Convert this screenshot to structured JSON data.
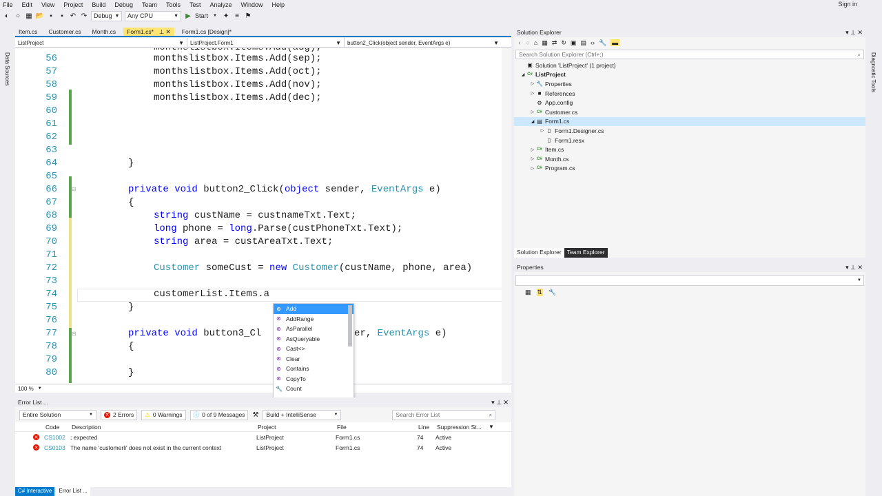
{
  "menu": [
    "File",
    "Edit",
    "View",
    "Project",
    "Build",
    "Debug",
    "Team",
    "Tools",
    "Test",
    "Analyze",
    "Window",
    "Help"
  ],
  "signin": "Sign in",
  "toolbar": {
    "config": "Debug",
    "platform": "Any CPU",
    "start": "Start"
  },
  "left_strip": "Data Sources",
  "right_strip": "Diagnostic Tools",
  "tabs": [
    "Item.cs",
    "Customer.cs",
    "Month.cs",
    "Form1.cs*",
    "Form1.cs [Design]*"
  ],
  "navbar": {
    "project": "ListProject",
    "class": "ListProject.Form1",
    "member": "button2_Click(object sender, EventArgs e)"
  },
  "zoom": "100 %",
  "code_lines": [
    {
      "n": "56",
      "text": "monthslistbox.Items.Add(sep);"
    },
    {
      "n": "57",
      "text": "monthslistbox.Items.Add(oct);"
    },
    {
      "n": "58",
      "text": "monthslistbox.Items.Add(nov);"
    },
    {
      "n": "59",
      "text": "monthslistbox.Items.Add(dec);"
    },
    {
      "n": "60",
      "text": ""
    },
    {
      "n": "61",
      "text": ""
    },
    {
      "n": "62",
      "text": ""
    },
    {
      "n": "63",
      "text": ""
    },
    {
      "n": "64",
      "text": "}"
    },
    {
      "n": "65",
      "text": ""
    },
    {
      "n": "66"
    },
    {
      "n": "67",
      "text": "{"
    },
    {
      "n": "68"
    },
    {
      "n": "69"
    },
    {
      "n": "70"
    },
    {
      "n": "71",
      "text": ""
    },
    {
      "n": "72"
    },
    {
      "n": "73",
      "text": ""
    },
    {
      "n": "74",
      "text": "customerList.Items.a"
    },
    {
      "n": "75",
      "text": "}"
    },
    {
      "n": "76",
      "text": ""
    },
    {
      "n": "77"
    },
    {
      "n": "78",
      "text": "{"
    },
    {
      "n": "79",
      "text": ""
    },
    {
      "n": "80",
      "text": "}"
    }
  ],
  "partial_top": "monthslistbox.Items.Add(aug);",
  "tokens": {
    "private": "private",
    "void": "void",
    "object": "object",
    "string": "string",
    "long": "long",
    "new": "new",
    "eventargs": "EventArgs",
    "customer": "Customer",
    "b2": " button2_Click(",
    "sender_e": " sender, ",
    "e_close": " e)",
    "l68": " custName = custnameTxt.Text;",
    "l69a": " phone = ",
    "l69b": ".Parse(custPhoneTxt.Text);",
    "l70": " area = custAreaTxt.Text;",
    "l72a": " someCust = ",
    "l72b": "(custName, phone, area)",
    "b3": " button3_Cl",
    "b3b": "nder, "
  },
  "intellisense": {
    "items": [
      "Add",
      "AddRange",
      "AsParallel",
      "AsQueryable",
      "Cast<>",
      "Clear",
      "Contains",
      "CopyTo",
      "Count"
    ],
    "selected": 0
  },
  "errorlist": {
    "title": "Error List ...",
    "scope": "Entire Solution",
    "errors": "2 Errors",
    "warnings": "0 Warnings",
    "messages": "0 of 9 Messages",
    "build": "Build + IntelliSense",
    "search_placeholder": "Search Error List",
    "columns": [
      "Code",
      "Description",
      "Project",
      "File",
      "Line",
      "Suppression St..."
    ],
    "rows": [
      {
        "code": "CS1002",
        "desc": "; expected",
        "project": "ListProject",
        "file": "Form1.cs",
        "line": "74",
        "supp": "Active"
      },
      {
        "code": "CS0103",
        "desc": "The name 'customerli' does not exist in the current context",
        "project": "ListProject",
        "file": "Form1.cs",
        "line": "74",
        "supp": "Active"
      }
    ]
  },
  "bottom_tabs": [
    "C# Interactive",
    "Error List ..."
  ],
  "solution": {
    "title": "Solution Explorer",
    "search_placeholder": "Search Solution Explorer (Ctrl+;)",
    "tree": [
      {
        "label": "Solution 'ListProject' (1 project)",
        "depth": 0,
        "exp": "",
        "ico": "▣"
      },
      {
        "label": "ListProject",
        "depth": 0,
        "exp": "◢",
        "ico": "C#",
        "bold": true
      },
      {
        "label": "Properties",
        "depth": 1,
        "exp": "▷",
        "ico": "🔧"
      },
      {
        "label": "References",
        "depth": 1,
        "exp": "▷",
        "ico": "■"
      },
      {
        "label": "App.config",
        "depth": 1,
        "exp": "",
        "ico": "⚙"
      },
      {
        "label": "Customer.cs",
        "depth": 1,
        "exp": "▷",
        "ico": "C#"
      },
      {
        "label": "Form1.cs",
        "depth": 1,
        "exp": "◢",
        "ico": "▤",
        "sel": true
      },
      {
        "label": "Form1.Designer.cs",
        "depth": 2,
        "exp": "▷",
        "ico": "▯"
      },
      {
        "label": "Form1.resx",
        "depth": 2,
        "exp": "",
        "ico": "▯"
      },
      {
        "label": "Item.cs",
        "depth": 1,
        "exp": "▷",
        "ico": "C#"
      },
      {
        "label": "Month.cs",
        "depth": 1,
        "exp": "▷",
        "ico": "C#"
      },
      {
        "label": "Program.cs",
        "depth": 1,
        "exp": "▷",
        "ico": "C#"
      }
    ]
  },
  "sol_tabs": [
    "Solution Explorer",
    "Team Explorer"
  ],
  "properties": {
    "title": "Properties"
  },
  "colors": {
    "accent": "#007acc",
    "keyword": "#0000ff",
    "type": "#2b91af",
    "active_tab": "#ffe472"
  }
}
